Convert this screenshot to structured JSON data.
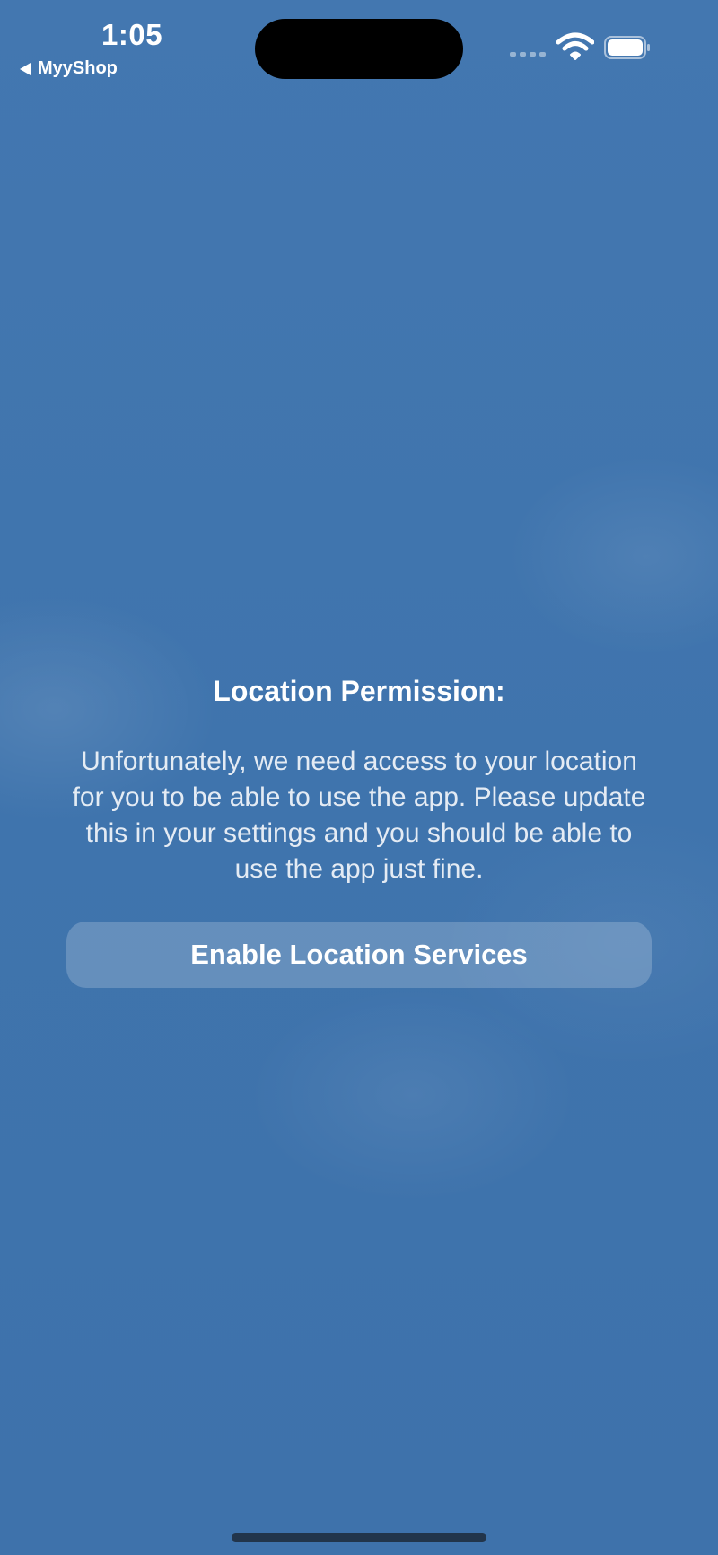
{
  "status_bar": {
    "time": "1:05",
    "back_app_label": "MyyShop",
    "icons": [
      "cellular-signal-icon",
      "wifi-icon",
      "battery-icon"
    ]
  },
  "permission": {
    "title": "Location Permission:",
    "message": "Unfortunately, we need access to your location for you to be able to use the app. Please update this in your settings and you should be able to use the app just fine.",
    "button_label": "Enable Location Services"
  },
  "colors": {
    "background": "#4176ae",
    "text": "#ffffff",
    "button_fill": "rgba(255,255,255,0.20)"
  }
}
